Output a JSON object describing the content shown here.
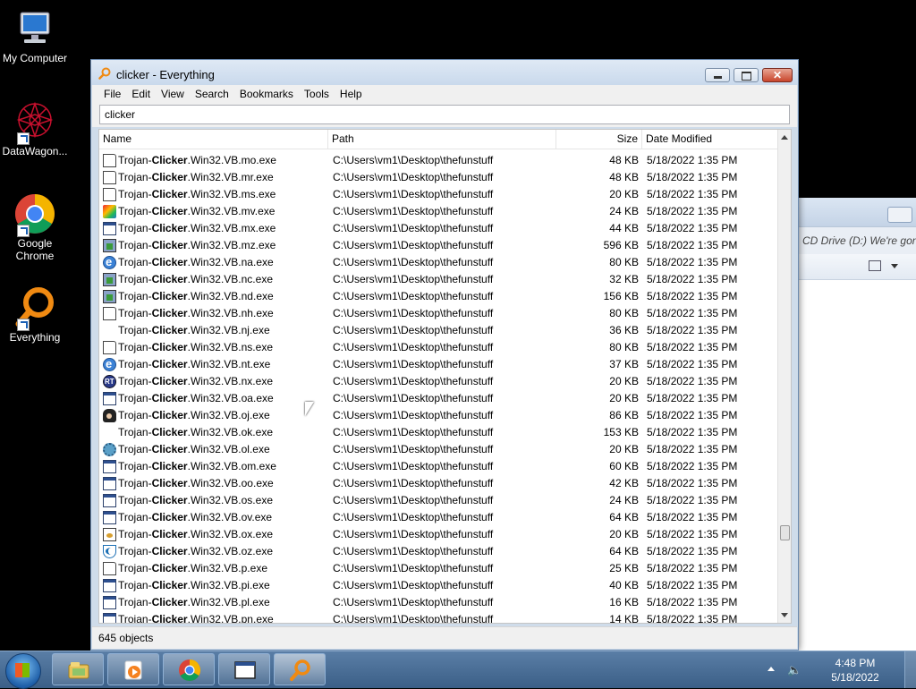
{
  "desktop": {
    "icons": [
      {
        "label": "My Computer"
      },
      {
        "label": "DataWagon..."
      },
      {
        "label": "Google Chrome"
      },
      {
        "label": "Everything"
      }
    ]
  },
  "background_window": {
    "address_text": "CD Drive (D:) We're gonna"
  },
  "window": {
    "title": "clicker - Everything",
    "close_glyph": "✕",
    "menu": [
      "File",
      "Edit",
      "View",
      "Search",
      "Bookmarks",
      "Tools",
      "Help"
    ],
    "search": {
      "value": "clicker",
      "placeholder": ""
    },
    "columns": {
      "name": "Name",
      "path": "Path",
      "size": "Size",
      "date": "Date Modified"
    },
    "rows": [
      {
        "icon": "doc",
        "prefix": "Trojan-",
        "match": "Clicker",
        "suffix": ".Win32.VB.mo.exe",
        "path": "C:\\Users\\vm1\\Desktop\\thefunstuff",
        "size": "48 KB",
        "date": "5/18/2022 1:35 PM"
      },
      {
        "icon": "doc",
        "prefix": "Trojan-",
        "match": "Clicker",
        "suffix": ".Win32.VB.mr.exe",
        "path": "C:\\Users\\vm1\\Desktop\\thefunstuff",
        "size": "48 KB",
        "date": "5/18/2022 1:35 PM"
      },
      {
        "icon": "doc",
        "prefix": "Trojan-",
        "match": "Clicker",
        "suffix": ".Win32.VB.ms.exe",
        "path": "C:\\Users\\vm1\\Desktop\\thefunstuff",
        "size": "20 KB",
        "date": "5/18/2022 1:35 PM"
      },
      {
        "icon": "color",
        "prefix": "Trojan-",
        "match": "Clicker",
        "suffix": ".Win32.VB.mv.exe",
        "path": "C:\\Users\\vm1\\Desktop\\thefunstuff",
        "size": "24 KB",
        "date": "5/18/2022 1:35 PM"
      },
      {
        "icon": "win-app",
        "prefix": "Trojan-",
        "match": "Clicker",
        "suffix": ".Win32.VB.mx.exe",
        "path": "C:\\Users\\vm1\\Desktop\\thefunstuff",
        "size": "44 KB",
        "date": "5/18/2022 1:35 PM"
      },
      {
        "icon": "setup",
        "prefix": "Trojan-",
        "match": "Clicker",
        "suffix": ".Win32.VB.mz.exe",
        "path": "C:\\Users\\vm1\\Desktop\\thefunstuff",
        "size": "596 KB",
        "date": "5/18/2022 1:35 PM"
      },
      {
        "icon": "ie",
        "prefix": "Trojan-",
        "match": "Clicker",
        "suffix": ".Win32.VB.na.exe",
        "path": "C:\\Users\\vm1\\Desktop\\thefunstuff",
        "size": "80 KB",
        "date": "5/18/2022 1:35 PM"
      },
      {
        "icon": "setup",
        "prefix": "Trojan-",
        "match": "Clicker",
        "suffix": ".Win32.VB.nc.exe",
        "path": "C:\\Users\\vm1\\Desktop\\thefunstuff",
        "size": "32 KB",
        "date": "5/18/2022 1:35 PM"
      },
      {
        "icon": "setup",
        "prefix": "Trojan-",
        "match": "Clicker",
        "suffix": ".Win32.VB.nd.exe",
        "path": "C:\\Users\\vm1\\Desktop\\thefunstuff",
        "size": "156 KB",
        "date": "5/18/2022 1:35 PM"
      },
      {
        "icon": "doc",
        "prefix": "Trojan-",
        "match": "Clicker",
        "suffix": ".Win32.VB.nh.exe",
        "path": "C:\\Users\\vm1\\Desktop\\thefunstuff",
        "size": "80 KB",
        "date": "5/18/2022 1:35 PM"
      },
      {
        "icon": "blank",
        "prefix": "Trojan-",
        "match": "Clicker",
        "suffix": ".Win32.VB.nj.exe",
        "path": "C:\\Users\\vm1\\Desktop\\thefunstuff",
        "size": "36 KB",
        "date": "5/18/2022 1:35 PM"
      },
      {
        "icon": "doc",
        "prefix": "Trojan-",
        "match": "Clicker",
        "suffix": ".Win32.VB.ns.exe",
        "path": "C:\\Users\\vm1\\Desktop\\thefunstuff",
        "size": "80 KB",
        "date": "5/18/2022 1:35 PM"
      },
      {
        "icon": "ie",
        "prefix": "Trojan-",
        "match": "Clicker",
        "suffix": ".Win32.VB.nt.exe",
        "path": "C:\\Users\\vm1\\Desktop\\thefunstuff",
        "size": "37 KB",
        "date": "5/18/2022 1:35 PM"
      },
      {
        "icon": "ns",
        "prefix": "Trojan-",
        "match": "Clicker",
        "suffix": ".Win32.VB.nx.exe",
        "path": "C:\\Users\\vm1\\Desktop\\thefunstuff",
        "size": "20 KB",
        "date": "5/18/2022 1:35 PM"
      },
      {
        "icon": "win-app",
        "prefix": "Trojan-",
        "match": "Clicker",
        "suffix": ".Win32.VB.oa.exe",
        "path": "C:\\Users\\vm1\\Desktop\\thefunstuff",
        "size": "20 KB",
        "date": "5/18/2022 1:35 PM"
      },
      {
        "icon": "face",
        "prefix": "Trojan-",
        "match": "Clicker",
        "suffix": ".Win32.VB.oj.exe",
        "path": "C:\\Users\\vm1\\Desktop\\thefunstuff",
        "size": "86 KB",
        "date": "5/18/2022 1:35 PM"
      },
      {
        "icon": "blank",
        "prefix": "Trojan-",
        "match": "Clicker",
        "suffix": ".Win32.VB.ok.exe",
        "path": "C:\\Users\\vm1\\Desktop\\thefunstuff",
        "size": "153 KB",
        "date": "5/18/2022 1:35 PM"
      },
      {
        "icon": "gear",
        "prefix": "Trojan-",
        "match": "Clicker",
        "suffix": ".Win32.VB.ol.exe",
        "path": "C:\\Users\\vm1\\Desktop\\thefunstuff",
        "size": "20 KB",
        "date": "5/18/2022 1:35 PM"
      },
      {
        "icon": "win-app",
        "prefix": "Trojan-",
        "match": "Clicker",
        "suffix": ".Win32.VB.om.exe",
        "path": "C:\\Users\\vm1\\Desktop\\thefunstuff",
        "size": "60 KB",
        "date": "5/18/2022 1:35 PM"
      },
      {
        "icon": "win-app",
        "prefix": "Trojan-",
        "match": "Clicker",
        "suffix": ".Win32.VB.oo.exe",
        "path": "C:\\Users\\vm1\\Desktop\\thefunstuff",
        "size": "42 KB",
        "date": "5/18/2022 1:35 PM"
      },
      {
        "icon": "win-app",
        "prefix": "Trojan-",
        "match": "Clicker",
        "suffix": ".Win32.VB.os.exe",
        "path": "C:\\Users\\vm1\\Desktop\\thefunstuff",
        "size": "24 KB",
        "date": "5/18/2022 1:35 PM"
      },
      {
        "icon": "win-app",
        "prefix": "Trojan-",
        "match": "Clicker",
        "suffix": ".Win32.VB.ov.exe",
        "path": "C:\\Users\\vm1\\Desktop\\thefunstuff",
        "size": "64 KB",
        "date": "5/18/2022 1:35 PM"
      },
      {
        "icon": "star",
        "prefix": "Trojan-",
        "match": "Clicker",
        "suffix": ".Win32.VB.ox.exe",
        "path": "C:\\Users\\vm1\\Desktop\\thefunstuff",
        "size": "20 KB",
        "date": "5/18/2022 1:35 PM"
      },
      {
        "icon": "shell",
        "prefix": "Trojan-",
        "match": "Clicker",
        "suffix": ".Win32.VB.oz.exe",
        "path": "C:\\Users\\vm1\\Desktop\\thefunstuff",
        "size": "64 KB",
        "date": "5/18/2022 1:35 PM"
      },
      {
        "icon": "doc",
        "prefix": "Trojan-",
        "match": "Clicker",
        "suffix": ".Win32.VB.p.exe",
        "path": "C:\\Users\\vm1\\Desktop\\thefunstuff",
        "size": "25 KB",
        "date": "5/18/2022 1:35 PM"
      },
      {
        "icon": "win-app",
        "prefix": "Trojan-",
        "match": "Clicker",
        "suffix": ".Win32.VB.pi.exe",
        "path": "C:\\Users\\vm1\\Desktop\\thefunstuff",
        "size": "40 KB",
        "date": "5/18/2022 1:35 PM"
      },
      {
        "icon": "win-app",
        "prefix": "Trojan-",
        "match": "Clicker",
        "suffix": ".Win32.VB.pl.exe",
        "path": "C:\\Users\\vm1\\Desktop\\thefunstuff",
        "size": "16 KB",
        "date": "5/18/2022 1:35 PM"
      },
      {
        "icon": "win-app",
        "prefix": "Trojan-",
        "match": "Clicker",
        "suffix": ".Win32.VB.pn.exe",
        "path": "C:\\Users\\vm1\\Desktop\\thefunstuff",
        "size": "14 KB",
        "date": "5/18/2022 1:35 PM"
      }
    ],
    "status": "645 objects",
    "scroll_position": 0.85
  },
  "taskbar": {
    "buttons": [
      "explorer-icon",
      "media-player-icon",
      "chrome-icon",
      "window-icon",
      "everything-icon"
    ],
    "active": "everything-icon",
    "clock": {
      "time": "4:48 PM",
      "date": "5/18/2022"
    }
  }
}
